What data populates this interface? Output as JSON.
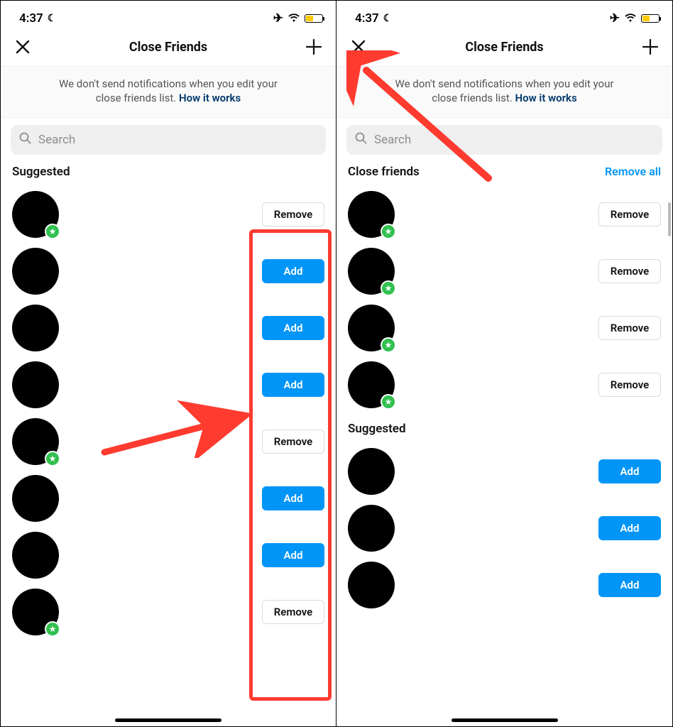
{
  "status": {
    "time": "4:37",
    "battery_pct": 40
  },
  "header": {
    "title": "Close Friends"
  },
  "info": {
    "text_a": "We don't send notifications when you edit your",
    "text_b": "close friends list.",
    "link": "How it works"
  },
  "search": {
    "placeholder": "Search"
  },
  "labels": {
    "suggested": "Suggested",
    "close_friends": "Close friends",
    "remove_all": "Remove all",
    "add": "Add",
    "remove": "Remove"
  },
  "left": {
    "rows": [
      {
        "star": true,
        "action": "remove"
      },
      {
        "star": false,
        "action": "add"
      },
      {
        "star": false,
        "action": "add"
      },
      {
        "star": false,
        "action": "add"
      },
      {
        "star": true,
        "action": "remove"
      },
      {
        "star": false,
        "action": "add"
      },
      {
        "star": false,
        "action": "add"
      },
      {
        "star": true,
        "action": "remove"
      }
    ]
  },
  "right": {
    "close_friends_rows": [
      {
        "star": true,
        "action": "remove"
      },
      {
        "star": true,
        "action": "remove"
      },
      {
        "star": true,
        "action": "remove"
      },
      {
        "star": true,
        "action": "remove"
      }
    ],
    "suggested_rows": [
      {
        "star": false,
        "action": "add"
      },
      {
        "star": false,
        "action": "add"
      },
      {
        "star": false,
        "action": "add"
      }
    ]
  }
}
